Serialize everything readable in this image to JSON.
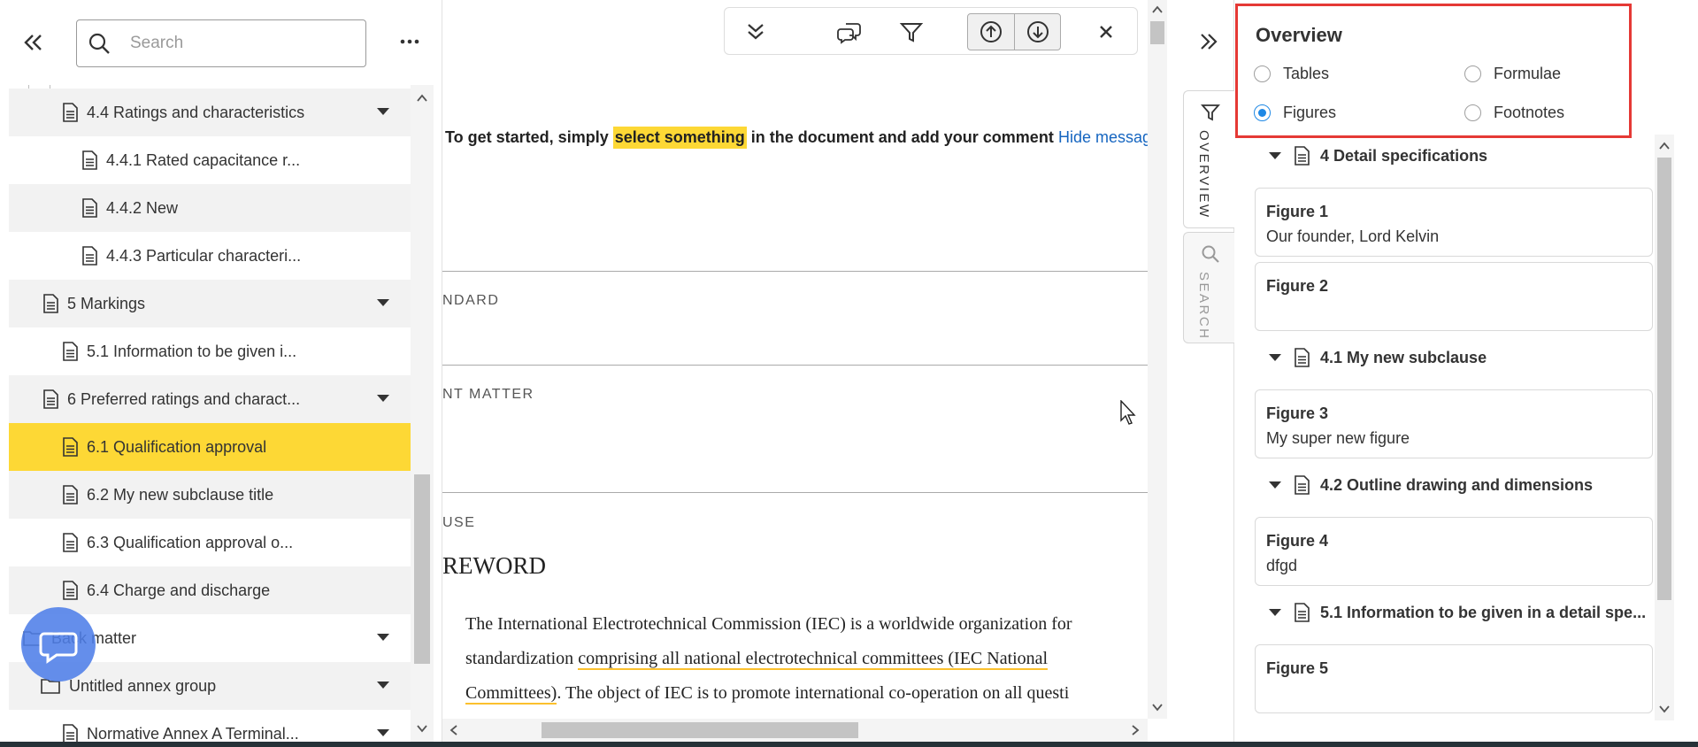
{
  "left_panel": {
    "search": {
      "placeholder": "Search",
      "value": ""
    },
    "tree": [
      {
        "label": "4.4 Ratings and characteristics",
        "expandable": true
      },
      {
        "label": "4.4.1 Rated capacitance r...",
        "expandable": false
      },
      {
        "label": "4.4.2 New",
        "expandable": false
      },
      {
        "label": "4.4.3 Particular characteri...",
        "expandable": false
      },
      {
        "label": "5 Markings",
        "expandable": true
      },
      {
        "label": "5.1 Information to be given i...",
        "expandable": false
      },
      {
        "label": "6 Preferred ratings and charact...",
        "expandable": true
      },
      {
        "label": "6.1 Qualification approval",
        "expandable": false,
        "selected": true
      },
      {
        "label": "6.2 My new subclause title",
        "expandable": false
      },
      {
        "label": "6.3 Qualification approval o...",
        "expandable": false
      },
      {
        "label": "6.4 Charge and discharge",
        "expandable": false
      },
      {
        "label": "Back matter",
        "expandable": true,
        "icon": "folder-icon"
      },
      {
        "label": "Untitled annex group",
        "expandable": true,
        "icon": "folder-icon"
      },
      {
        "label": "Normative Annex A Terminal...",
        "expandable": true
      }
    ]
  },
  "document": {
    "message": {
      "before": "To get started, simply",
      "highlight": "select something",
      "after": "in the document and add your comment",
      "hide_link": "Hide messag"
    },
    "sections": [
      {
        "label": "NDARD"
      },
      {
        "label": "NT MATTER"
      },
      {
        "label": "USE"
      }
    ],
    "heading": "REWORD",
    "paragraph": {
      "line1": "The International Electrotechnical Commission (IEC) is a worldwide organization for",
      "line2_plain": "standardization ",
      "line2_ul": "comprising all national electrotechnical committees (IEC National",
      "line3_ul": "Committees)",
      "line3_rest": ". The object of IEC is to promote international co-operation on all questi"
    }
  },
  "right_panel": {
    "tabs": {
      "overview": "OVERVIEW",
      "search": "SEARCH"
    },
    "overview": {
      "title": "Overview",
      "filters": {
        "tables": "Tables",
        "formulae": "Formulae",
        "figures": "Figures",
        "footnotes": "Footnotes"
      },
      "selected_filter": "Figures",
      "groups": [
        {
          "title": "4 Detail specifications",
          "figures": [
            {
              "title": "Figure 1",
              "caption": "Our founder, Lord Kelvin"
            },
            {
              "title": "Figure 2",
              "caption": ""
            }
          ]
        },
        {
          "title": "4.1 My new subclause",
          "figures": [
            {
              "title": "Figure 3",
              "caption": "My super new figure"
            }
          ]
        },
        {
          "title": "4.2 Outline drawing and dimensions",
          "figures": [
            {
              "title": "Figure 4",
              "caption": "dfgd"
            }
          ]
        },
        {
          "title": "5.1 Information to be given in a detail spe...",
          "figures": [
            {
              "title": "Figure 5",
              "caption": ""
            }
          ]
        }
      ]
    }
  },
  "colors": {
    "selection": "#fdd835",
    "link": "#1565c0",
    "accent_radio": "#1e88e5",
    "highlight_box": "#e53935",
    "chat_button": "#4f7ee8"
  }
}
